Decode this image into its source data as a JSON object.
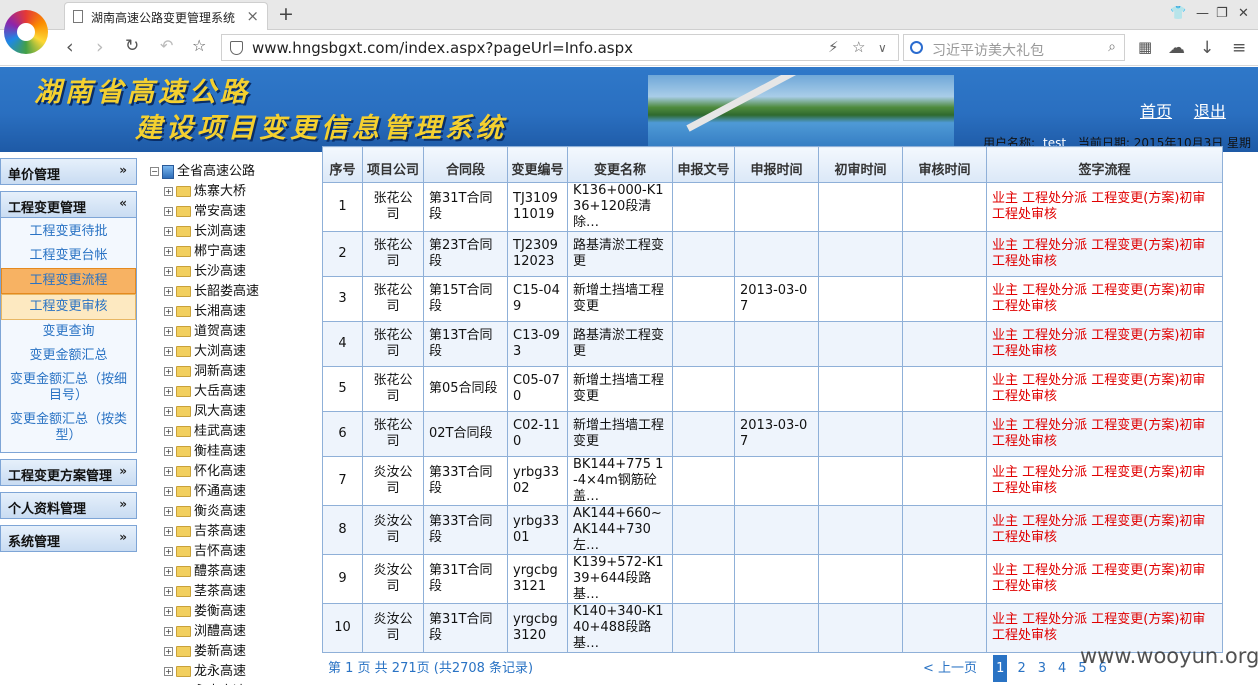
{
  "browser": {
    "tab_title": "湖南高速公路变更管理系统",
    "tab_close": "×",
    "new_tab": "+",
    "url": "www.hngsbgxt.com/index.aspx?pageUrl=Info.aspx",
    "search_placeholder": "习近平访美大礼包"
  },
  "header": {
    "title_line1": "湖南省高速公路",
    "title_line2": "建设项目变更信息管理系统",
    "home_link": "首页",
    "logout_link": "退出",
    "user_label": "用户名称:",
    "user_name": "test",
    "date_label": "当前日期:",
    "date_value": "2015年10月3日 星期"
  },
  "sidebar": {
    "sections": [
      {
        "label": "单价管理",
        "chevron": "»"
      },
      {
        "label": "工程变更管理",
        "chevron": "«"
      },
      {
        "label": "工程变更方案管理",
        "chevron": "»"
      },
      {
        "label": "个人资料管理",
        "chevron": "»"
      },
      {
        "label": "系统管理",
        "chevron": "»"
      }
    ],
    "items": [
      "工程变更待批",
      "工程变更台帐",
      "工程变更流程",
      "工程变更审核",
      "变更查询",
      "变更金额汇总",
      "变更金额汇总（按细目号）",
      "变更金额汇总（按类型）"
    ]
  },
  "tree": {
    "root": "全省高速公路",
    "nodes": [
      "炼寨大桥",
      "常安高速",
      "长浏高速",
      "郴宁高速",
      "长沙高速",
      "长韶娄高速",
      "长湘高速",
      "道贺高速",
      "大浏高速",
      "洞新高速",
      "大岳高速",
      "凤大高速",
      "桂武高速",
      "衡桂高速",
      "怀化高速",
      "怀通高速",
      "衡炎高速",
      "吉茶高速",
      "吉怀高速",
      "醴茶高速",
      "茎茶高速",
      "娄衡高速",
      "浏醴高速",
      "娄新高速",
      "龙永高速",
      "永吉高速"
    ]
  },
  "table": {
    "headers": [
      "序号",
      "项目公司",
      "合同段",
      "变更编号",
      "变更名称",
      "申报文号",
      "申报时间",
      "初审时间",
      "审核时间",
      "签字流程"
    ],
    "rows": [
      [
        "1",
        "张花公司",
        "第31T合同段",
        "TJ3109 11019",
        "K136+000-K136+120段清除…",
        "",
        "",
        "",
        "",
        "业主 工程处分派 工程变更(方案)初审 工程处审核"
      ],
      [
        "2",
        "张花公司",
        "第23T合同段",
        "TJ2309 12023",
        "路基清淤工程变更",
        "",
        "",
        "",
        "",
        "业主 工程处分派 工程变更(方案)初审 工程处审核"
      ],
      [
        "3",
        "张花公司",
        "第15T合同段",
        "C15-049",
        "新增土挡墙工程变更",
        "",
        "2013-03-07",
        "",
        "",
        "业主 工程处分派 工程变更(方案)初审 工程处审核"
      ],
      [
        "4",
        "张花公司",
        "第13T合同段",
        "C13-093",
        "路基清淤工程变更",
        "",
        "",
        "",
        "",
        "业主 工程处分派 工程变更(方案)初审 工程处审核"
      ],
      [
        "5",
        "张花公司",
        "第05合同段",
        "C05-070",
        "新增土挡墙工程变更",
        "",
        "",
        "",
        "",
        "业主 工程处分派 工程变更(方案)初审 工程处审核"
      ],
      [
        "6",
        "张花公司",
        "02T合同段",
        "C02-110",
        "新增土挡墙工程变更",
        "",
        "2013-03-07",
        "",
        "",
        "业主 工程处分派 工程变更(方案)初审 工程处审核"
      ],
      [
        "7",
        "炎汝公司",
        "第33T合同段",
        "yrbg3302",
        "BK144+775 1-4×4m钢筋砼盖…",
        "",
        "",
        "",
        "",
        "业主 工程处分派 工程变更(方案)初审 工程处审核"
      ],
      [
        "8",
        "炎汝公司",
        "第33T合同段",
        "yrbg3301",
        "AK144+660~AK144+730左…",
        "",
        "",
        "",
        "",
        "业主 工程处分派 工程变更(方案)初审 工程处审核"
      ],
      [
        "9",
        "炎汝公司",
        "第31T合同段",
        "yrgcbg3121",
        "K139+572-K139+644段路基…",
        "",
        "",
        "",
        "",
        "业主 工程处分派 工程变更(方案)初审 工程处审核"
      ],
      [
        "10",
        "炎汝公司",
        "第31T合同段",
        "yrgcbg3120",
        "K140+340-K140+488段路基…",
        "",
        "",
        "",
        "",
        "业主 工程处分派 工程变更(方案)初审 工程处审核"
      ]
    ]
  },
  "pager": {
    "summary": "第 1 页 共 271页 (共2708 条记录)",
    "prev": "< 上一页",
    "pages": [
      "1",
      "2",
      "3",
      "4",
      "5",
      "6"
    ]
  },
  "watermark": "www.wooyun.org"
}
